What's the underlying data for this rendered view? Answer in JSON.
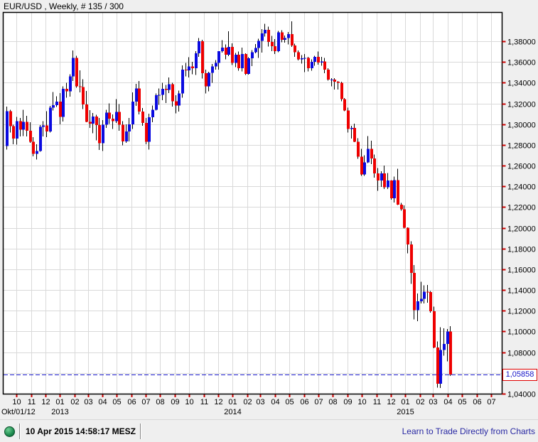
{
  "window": {
    "title": "EUR/USD , Weekly, # 135 / 300"
  },
  "status_bar": {
    "timestamp": "10 Apr 2015 14:58:17 MESZ",
    "link": "Learn to Trade Directly from Charts"
  },
  "time_axis": {
    "start_label": "Okt/01/12",
    "months": [
      "10",
      "11",
      "12",
      "01",
      "02",
      "03",
      "04",
      "05",
      "06",
      "07",
      "08",
      "09",
      "10",
      "11",
      "12",
      "01",
      "02",
      "03",
      "04",
      "05",
      "06",
      "07",
      "08",
      "09",
      "10",
      "11",
      "12",
      "01",
      "02",
      "03",
      "04",
      "05",
      "06",
      "07"
    ],
    "years": [
      "2013",
      "2014",
      "2015"
    ]
  },
  "colors": {
    "up": "#0b0be0",
    "down": "#ee0000",
    "wick": "#000000",
    "grid": "#d9d9d9",
    "axis_tick": "#cc0000",
    "current_price": "#1515c8",
    "background": "#efefef",
    "plot_bg": "#ffffff",
    "border": "#000000",
    "text": "#000000"
  },
  "chart_data": {
    "type": "candlestick",
    "symbol": "EUR/USD",
    "timeframe": "Weekly",
    "bars_shown": 135,
    "bars_total": 300,
    "first_bar_week": "2012-09-10",
    "interval": "1W",
    "current_price": 1.05858,
    "current_price_label": "1,05858",
    "price_axis": {
      "min": 1.04,
      "max": 1.38,
      "step": 0.02,
      "labels": [
        "1,38000",
        "1,36000",
        "1,34000",
        "1,32000",
        "1,30000",
        "1,28000",
        "1,26000",
        "1,24000",
        "1,22000",
        "1,20000",
        "1,18000",
        "1,16000",
        "1,14000",
        "1,12000",
        "1,10000",
        "1,08000",
        "1,04000"
      ],
      "label_values": [
        1.38,
        1.36,
        1.34,
        1.32,
        1.3,
        1.28,
        1.26,
        1.24,
        1.22,
        1.2,
        1.18,
        1.16,
        1.14,
        1.12,
        1.1,
        1.08,
        1.04
      ]
    },
    "candles": [
      [
        1.279,
        1.317,
        1.2755,
        1.3125
      ],
      [
        1.3125,
        1.314,
        1.292,
        1.298
      ],
      [
        1.298,
        1.2995,
        1.2805,
        1.286
      ],
      [
        1.286,
        1.307,
        1.2803,
        1.303
      ],
      [
        1.303,
        1.306,
        1.288,
        1.2945
      ],
      [
        1.2945,
        1.314,
        1.2885,
        1.3022
      ],
      [
        1.3022,
        1.308,
        1.2882,
        1.2935
      ],
      [
        1.2935,
        1.302,
        1.282,
        1.283
      ],
      [
        1.283,
        1.2875,
        1.269,
        1.2712
      ],
      [
        1.2712,
        1.2805,
        1.266,
        1.2742
      ],
      [
        1.2742,
        1.299,
        1.2735,
        1.2975
      ],
      [
        1.2975,
        1.303,
        1.288,
        1.2986
      ],
      [
        1.2986,
        1.3125,
        1.2875,
        1.293
      ],
      [
        1.293,
        1.3175,
        1.292,
        1.316
      ],
      [
        1.316,
        1.331,
        1.313,
        1.3183
      ],
      [
        1.3183,
        1.327,
        1.3165,
        1.3218
      ],
      [
        1.3218,
        1.33,
        1.2998,
        1.307
      ],
      [
        1.307,
        1.3365,
        1.3025,
        1.334
      ],
      [
        1.334,
        1.34,
        1.3255,
        1.3318
      ],
      [
        1.3318,
        1.348,
        1.3265,
        1.346
      ],
      [
        1.346,
        1.3711,
        1.3415,
        1.364
      ],
      [
        1.364,
        1.366,
        1.335,
        1.3365
      ],
      [
        1.3365,
        1.352,
        1.3305,
        1.3358
      ],
      [
        1.3358,
        1.3434,
        1.3145,
        1.319
      ],
      [
        1.319,
        1.332,
        1.3018,
        1.3022
      ],
      [
        1.3022,
        1.3135,
        1.2965,
        1.3005
      ],
      [
        1.3005,
        1.3108,
        1.2911,
        1.3075
      ],
      [
        1.3075,
        1.309,
        1.2843,
        1.299
      ],
      [
        1.299,
        1.306,
        1.275,
        1.2817
      ],
      [
        1.2817,
        1.304,
        1.274,
        1.2994
      ],
      [
        1.2994,
        1.3138,
        1.2965,
        1.311
      ],
      [
        1.311,
        1.32,
        1.3,
        1.3052
      ],
      [
        1.3052,
        1.3094,
        1.2954,
        1.303
      ],
      [
        1.303,
        1.324,
        1.301,
        1.3118
      ],
      [
        1.3118,
        1.3195,
        1.2935,
        1.2993
      ],
      [
        1.2993,
        1.303,
        1.2795,
        1.2833
      ],
      [
        1.2833,
        1.2998,
        1.282,
        1.293
      ],
      [
        1.293,
        1.306,
        1.2835,
        1.2998
      ],
      [
        1.2998,
        1.3307,
        1.2955,
        1.3217
      ],
      [
        1.3217,
        1.339,
        1.3175,
        1.3345
      ],
      [
        1.3345,
        1.3415,
        1.3095,
        1.3122
      ],
      [
        1.3122,
        1.3155,
        1.2985,
        1.301
      ],
      [
        1.301,
        1.306,
        1.2805,
        1.283
      ],
      [
        1.283,
        1.31,
        1.2755,
        1.3068
      ],
      [
        1.3068,
        1.318,
        1.302,
        1.314
      ],
      [
        1.314,
        1.3295,
        1.313,
        1.328
      ],
      [
        1.328,
        1.3345,
        1.3185,
        1.3282
      ],
      [
        1.3282,
        1.34,
        1.323,
        1.334
      ],
      [
        1.334,
        1.338,
        1.3205,
        1.333
      ],
      [
        1.333,
        1.3452,
        1.33,
        1.3385
      ],
      [
        1.3385,
        1.34,
        1.317,
        1.322
      ],
      [
        1.322,
        1.328,
        1.3105,
        1.318
      ],
      [
        1.318,
        1.3325,
        1.312,
        1.3295
      ],
      [
        1.3295,
        1.3568,
        1.3255,
        1.3525
      ],
      [
        1.3525,
        1.359,
        1.346,
        1.352
      ],
      [
        1.352,
        1.3645,
        1.345,
        1.3555
      ],
      [
        1.3555,
        1.36,
        1.348,
        1.354
      ],
      [
        1.354,
        1.3705,
        1.3475,
        1.3685
      ],
      [
        1.3685,
        1.3832,
        1.365,
        1.38
      ],
      [
        1.38,
        1.3815,
        1.344,
        1.349
      ],
      [
        1.349,
        1.3525,
        1.3295,
        1.3365
      ],
      [
        1.3365,
        1.3505,
        1.3318,
        1.3495
      ],
      [
        1.3495,
        1.358,
        1.34,
        1.3555
      ],
      [
        1.3555,
        1.362,
        1.3525,
        1.359
      ],
      [
        1.359,
        1.3705,
        1.3525,
        1.3705
      ],
      [
        1.3705,
        1.381,
        1.369,
        1.374
      ],
      [
        1.374,
        1.377,
        1.3625,
        1.367
      ],
      [
        1.367,
        1.3895,
        1.3655,
        1.3745
      ],
      [
        1.3745,
        1.378,
        1.357,
        1.359
      ],
      [
        1.359,
        1.3687,
        1.355,
        1.367
      ],
      [
        1.367,
        1.37,
        1.3515,
        1.354
      ],
      [
        1.354,
        1.374,
        1.3507,
        1.3678
      ],
      [
        1.3678,
        1.3685,
        1.3475,
        1.3485
      ],
      [
        1.3485,
        1.3645,
        1.3477,
        1.3635
      ],
      [
        1.3635,
        1.3715,
        1.356,
        1.3695
      ],
      [
        1.3695,
        1.3773,
        1.3685,
        1.3735
      ],
      [
        1.3735,
        1.3825,
        1.364,
        1.3802
      ],
      [
        1.3802,
        1.3915,
        1.369,
        1.3875
      ],
      [
        1.3875,
        1.3967,
        1.3845,
        1.391
      ],
      [
        1.391,
        1.394,
        1.375,
        1.3793
      ],
      [
        1.3793,
        1.385,
        1.3705,
        1.3753
      ],
      [
        1.3753,
        1.382,
        1.3675,
        1.3703
      ],
      [
        1.3703,
        1.39,
        1.3695,
        1.3885
      ],
      [
        1.3885,
        1.3905,
        1.379,
        1.3815
      ],
      [
        1.3815,
        1.3855,
        1.3785,
        1.3832
      ],
      [
        1.3832,
        1.389,
        1.377,
        1.387
      ],
      [
        1.387,
        1.3993,
        1.3745,
        1.376
      ],
      [
        1.376,
        1.3775,
        1.3648,
        1.3695
      ],
      [
        1.3695,
        1.371,
        1.3615,
        1.3625
      ],
      [
        1.3625,
        1.3668,
        1.3585,
        1.3635
      ],
      [
        1.3635,
        1.3675,
        1.3503,
        1.364
      ],
      [
        1.364,
        1.365,
        1.351,
        1.354
      ],
      [
        1.354,
        1.3625,
        1.3515,
        1.36
      ],
      [
        1.36,
        1.366,
        1.3565,
        1.365
      ],
      [
        1.365,
        1.37,
        1.3575,
        1.3595
      ],
      [
        1.3595,
        1.365,
        1.3565,
        1.3605
      ],
      [
        1.3605,
        1.364,
        1.349,
        1.3525
      ],
      [
        1.3525,
        1.354,
        1.342,
        1.343
      ],
      [
        1.343,
        1.3445,
        1.3365,
        1.343
      ],
      [
        1.343,
        1.3445,
        1.3335,
        1.341
      ],
      [
        1.341,
        1.3415,
        1.3335,
        1.34
      ],
      [
        1.34,
        1.341,
        1.322,
        1.324
      ],
      [
        1.324,
        1.325,
        1.3125,
        1.3133
      ],
      [
        1.3133,
        1.316,
        1.292,
        1.2952
      ],
      [
        1.2952,
        1.2985,
        1.286,
        1.2965
      ],
      [
        1.2965,
        1.3005,
        1.2826,
        1.283
      ],
      [
        1.283,
        1.2865,
        1.2665,
        1.2685
      ],
      [
        1.2685,
        1.276,
        1.25,
        1.2515
      ],
      [
        1.2515,
        1.27,
        1.25,
        1.263
      ],
      [
        1.263,
        1.2885,
        1.2625,
        1.276
      ],
      [
        1.276,
        1.284,
        1.2615,
        1.267
      ],
      [
        1.267,
        1.2705,
        1.2485,
        1.2525
      ],
      [
        1.2525,
        1.2575,
        1.2357,
        1.2455
      ],
      [
        1.2455,
        1.2545,
        1.2395,
        1.2525
      ],
      [
        1.2525,
        1.26,
        1.2375,
        1.239
      ],
      [
        1.239,
        1.253,
        1.2373,
        1.2455
      ],
      [
        1.2455,
        1.246,
        1.227,
        1.2285
      ],
      [
        1.2285,
        1.2495,
        1.2245,
        1.246
      ],
      [
        1.246,
        1.257,
        1.222,
        1.2225
      ],
      [
        1.2225,
        1.224,
        1.2165,
        1.218
      ],
      [
        1.218,
        1.2215,
        1.1995,
        1.2002
      ],
      [
        1.2002,
        1.2005,
        1.1755,
        1.184
      ],
      [
        1.184,
        1.187,
        1.146,
        1.1567
      ],
      [
        1.1567,
        1.164,
        1.1115,
        1.1205
      ],
      [
        1.1205,
        1.1365,
        1.1098,
        1.129
      ],
      [
        1.129,
        1.148,
        1.127,
        1.1315
      ],
      [
        1.1315,
        1.1445,
        1.127,
        1.1385
      ],
      [
        1.1385,
        1.145,
        1.1278,
        1.138
      ],
      [
        1.138,
        1.139,
        1.1183,
        1.1195
      ],
      [
        1.1195,
        1.124,
        1.0838,
        1.0845
      ],
      [
        1.0845,
        1.0905,
        1.0458,
        1.0495
      ],
      [
        1.0495,
        1.104,
        1.0455,
        1.082
      ],
      [
        1.082,
        1.103,
        1.0768,
        1.088
      ],
      [
        1.088,
        1.1025,
        1.0713,
        1.1
      ],
      [
        1.1,
        1.105,
        1.057,
        1.05858
      ]
    ]
  }
}
